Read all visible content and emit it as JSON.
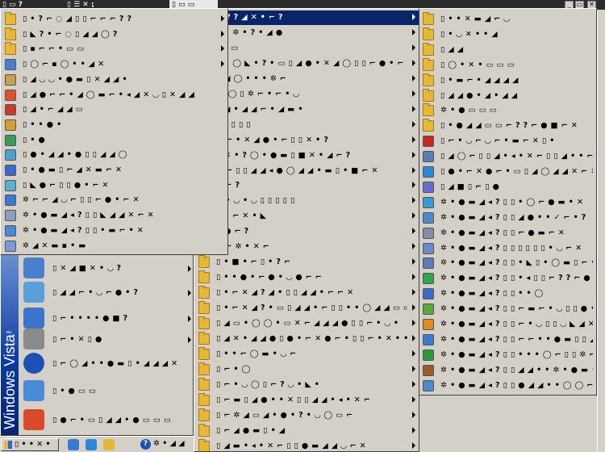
{
  "top_strip": {
    "item1": "▯ ▭ ?",
    "item2": "▯ ☰ ✕ ⁏",
    "item3": "▯ ▭ ▭",
    "win_controls": [
      "_",
      "▭",
      "✕"
    ]
  },
  "panel1": {
    "rows": [
      {
        "label": "▯ • ? ⌐ ◌ ◢ ▯ ▯ ⌐ ⌐ ⌐ ? ?",
        "icon": "folder",
        "submenu": true
      },
      {
        "label": "▯ ◣ ? • ⌐ ◌ ▯ ◢ ◢ ◯ ?",
        "icon": "folder",
        "submenu": true
      },
      {
        "label": "▯ ▪ ⌐ ⌐ • ▭ ▭",
        "icon": "folder",
        "submenu": true
      },
      {
        "label": "▯ ◯ ⌐ ▪ ◯ • • ◢ ✕",
        "icon": "app",
        "submenu": true
      },
      {
        "label": "▯ ◢ ◡ ◡ • ● ▬ ▯ ✕ ◢ ◢ •",
        "icon": "app",
        "submenu": false
      },
      {
        "label": "▯ ◢ ● ⌐ ⌐ • ◢ ◯ ▬ ⌐ • ◂ ◢ ✕ ◡ ▯ ✕ ◢ ◢",
        "icon": "app",
        "submenu": false
      },
      {
        "label": "▯ ◢ • ⌐ ◢ ◢ ▭",
        "icon": "app",
        "submenu": false
      },
      {
        "label": "▯ • • ● •",
        "icon": "app",
        "submenu": false
      },
      {
        "label": "▯ • ●",
        "icon": "app",
        "submenu": false
      },
      {
        "label": "▯ ● • ◢ ◢ • ● ▯ ▯ ◢ ◢ ◯",
        "icon": "app",
        "submenu": false
      },
      {
        "label": "▯ • ● ▬ ▯ ⌐ ◢ ✕ ▬ ⌐ ✕",
        "icon": "app",
        "submenu": false
      },
      {
        "label": "▯ ◣ ● ⌐ ▯ ▯ ● • ⌐ ✕",
        "icon": "app",
        "submenu": false
      },
      {
        "label": "✲ ⌐ ⌐ ◢ ◡ ⌐ ▯ ▯ ⌐ ● • ⌐ ✕",
        "icon": "app",
        "submenu": false
      },
      {
        "label": "✲ • ● ▬ ◢ ◂ ? ▯ ▯ ◣ ◢ ◢ ✕ ⌐ ✕",
        "icon": "app",
        "submenu": false
      },
      {
        "label": "✲ • ● ▬ ◢ ◂ ? ▯ ▯ • ▬ ⌐ • ✕",
        "icon": "app",
        "submenu": false
      },
      {
        "label": "✲ ◢ ✕ ▬ ▪ • ▬",
        "icon": "app",
        "submenu": false
      }
    ]
  },
  "start_menu": {
    "brand": "Windows Vista",
    "brand_tm": "™",
    "items": [
      {
        "label": "▯ ✕ ◢ ■ ✕ • ◡ ?",
        "color": "#4a7fd0"
      },
      {
        "label": "▯ ◢ ◢ ⌐ • ◡ ⌐ ● • ?",
        "color": "#5aa0d8"
      },
      {
        "label": "▯ ⌐ • • • • ● ■ ?",
        "color": "#3c74c8"
      },
      {
        "label": "▯ ⌐ • ✕ ▯ ●",
        "color": "#8a8a8a"
      },
      {
        "label": "▯ ⌐ ◯ ◢ • • ● ▬ ▯ • ◢ ◢ ◢ ✕",
        "color": "#1e4fb4"
      },
      {
        "label": "▯ • ● ▭ ▭",
        "color": "#4a8ad8"
      },
      {
        "label": "▯ ● ⌐ • ▭ ▯ ◢ ◢ • ● ▭ ▭ ▭",
        "color": "#d84a2a"
      }
    ]
  },
  "panel2": {
    "rows": [
      {
        "label": "⌐ ? ? ◢ ✕ • ⌐ ?",
        "selected": true
      },
      {
        "label": "• • ✲ • ? • ◢ ●",
        "selected": false
      },
      {
        "label": "▯ ◂ ▭",
        "selected": false
      },
      {
        "label": "• • ◯ ◣ • ? • ▭ ▯ ◢ ● • ✕ ◢ ◯ ▯ ▯ ⌐ ● • ⌐ ✕",
        "selected": false
      },
      {
        "label": "• ◢ ◯ • • • ✲ ⌐",
        "selected": false
      },
      {
        "label": "◯ ◯ ▯ ✲ ⌐ • ⌐ • ◡",
        "selected": false
      },
      {
        "label": "• ◢ • ◢ ◢ ⌐ • ◢ ▬ •",
        "selected": false
      },
      {
        "label": "▯ ▯ ▯ ▯ ▯",
        "selected": false
      },
      {
        "label": "⌐ ⌐ • ✕ ◢ ● • ⌐ ▯ ▯ ✕ • ?",
        "selected": false
      },
      {
        "label": "• ✕ • ? ◯ • ● ▬ ▯ ■ ✕ • ◢ ⌐ ?",
        "selected": false
      },
      {
        "label": "⌐ ⌐ ▯ ▯ ◢ ◢ ◂ ● ◯ ◢ ◢ • ▬ ▯ • ■ ⌐ ✕",
        "selected": false
      },
      {
        "label": "◡ ⌐ ?",
        "selected": false
      },
      {
        "label": "◢ • ◡ • ◡ ▯ ▯ ▯ ▯ ▯",
        "selected": false
      },
      {
        "label": "• • ⌐ ✕ • ◣",
        "selected": false
      },
      {
        "label": "• ● ⌐ ?",
        "selected": false
      },
      {
        "label": "◡ ⌐ ✲ • ✕ ⌐",
        "selected": false
      },
      {
        "label": "▯ • ■ • ⌐ ▯ • ? ⌐",
        "selected": false
      },
      {
        "label": "▯ • • ● • ⌐ ● • ◡ ● ⌐ ⌐",
        "selected": false
      },
      {
        "label": "▯ • ⌐ ✕ ◢ ? ◢ • ▯ ▯ ◢ ◢ • ⌐ ⌐ ✕",
        "selected": false
      },
      {
        "label": "▯ • ⌐ ✕ ◢ ? • ▭ ▯ ◢ ◢ • ⌐ ▯ ▯ • • ◯ ◢ ◢ ▭ ▭",
        "selected": false
      },
      {
        "label": "▯ ◢ ▭ • ◯ ◯ • ▭ ✕ ⌐ ◢ ◢ ◢ ● ▯ ▯ ⌐ • ◡ •",
        "selected": false
      },
      {
        "label": "▯ ◢ ✕ • ◢ ◢ ● ▯ ● • ⌐ ✕ ● ⌐ • ▯ ▯ ⌐ • ✕ • • ◣",
        "selected": false
      },
      {
        "label": "▯ • • ⌐ ◯ ▬ • ◡ ⌐",
        "selected": false
      },
      {
        "label": "▯ ⌐ • ◯",
        "selected": false
      },
      {
        "label": "▯ ⌐ • ◡ ◯ ▯ ⌐ ? ◡ • ◣ •",
        "selected": false
      },
      {
        "label": "▯ ⌐ ▬ ▯ ◢ ● • • ✕ ▯ ▯ ◢ ◢ • ◂ • ✕ ⌐",
        "selected": false
      },
      {
        "label": "▯ ⌐ ✲ ◢ ▭ ◢ • ● • ? • ◡ ◯ ▭ ⌐",
        "selected": false
      },
      {
        "label": "▯ ⌐ ◢ ● ▬ ▯ • ◢",
        "selected": false
      },
      {
        "label": "▯ ◢ ▬ • ◂ • ✕ ⌐ ▯ ▯ ● ▬ ◢ ◢ ◡ ⌐ ✕",
        "selected": false
      }
    ]
  },
  "panel3": {
    "rows": [
      {
        "label": "▯ • • ✕ ▬ ◢ ⌐ ◡",
        "icon": "folder",
        "color": "#e6b83a"
      },
      {
        "label": "▯ • ◡ ✕ • • ◢",
        "icon": "folder",
        "color": "#e6b83a"
      },
      {
        "label": "▯ ◢ ◢",
        "icon": "folder",
        "color": "#e6b83a"
      },
      {
        "label": "▯ ◯ • ✕ • ▭ ▭ ▭",
        "icon": "folder",
        "color": "#e6b83a"
      },
      {
        "label": "▯ • ▬ ⌐ • ◢ ◢ ◢ ◢",
        "icon": "folder",
        "color": "#e6b83a"
      },
      {
        "label": "▯ ◢ ◢ ● • ◢ • ◢ ◢",
        "icon": "folder",
        "color": "#e6b83a"
      },
      {
        "label": "✲ • ● ▭ ▭ ▭",
        "icon": "folder",
        "color": "#e6b83a"
      },
      {
        "label": "▯ • ● ◢ ◢ ▭ ▭ ⌐ ? ? ⌐ ● ■ ⌐ ✕",
        "icon": "folder",
        "color": "#e6b83a"
      },
      {
        "label": "▯ ⌐ • ◡ ⌐ ◡ ⌐ • ▬ ⌐ ✕ ▯ •",
        "icon": "app",
        "color": "#c8281e"
      },
      {
        "label": "▯ ◢ ◯ ⌐ ▯ ▯ ◢ • ◂ • ✕ ⌐ ▯ ▯ ◢ • • ⌐",
        "icon": "app",
        "color": "#5a7ab8"
      },
      {
        "label": "▯ ● • ⌐ ✕ ● ⌐ • ▭ ▯ ◢ ◯ ◢ ◢ ✕ ⌐ ✕",
        "icon": "app",
        "color": "#2a8ad8"
      },
      {
        "label": "▯ ◢ ■ ▯ ⌐ ▯ ●",
        "icon": "app",
        "color": "#6a6ad0"
      },
      {
        "label": "✲ • ● ▬ ◢ ◂ ? ▯ ▯ • ◯ ⌐ ● ▬ • ✕",
        "icon": "app",
        "color": "#3a9ad8"
      },
      {
        "label": "✲ • ● ▬ ◢ ◂ ? ▯ ▯ ◢ ● • • ✓ ⌐ • ?",
        "icon": "app",
        "color": "#4a8ac8"
      },
      {
        "label": "✲ • ● ▬ ◢ ◂ ? ▯ ▯ ⌐ ● ▬ ⌐ ✕",
        "icon": "app",
        "color": "#8a8aa8"
      },
      {
        "label": "✲ • ● ▬ ◢ ◂ ? ▯ ▯ ▯ ▯ ▯ ▯ • ◡ ⌐ ✕",
        "icon": "app",
        "color": "#6a8ac8"
      },
      {
        "label": "✲ • ● ▬ ◢ ◂ ? ▯ ▯ • ◣ ▯ • ◯ ▬ ▯ ⌐ • ●",
        "icon": "app",
        "color": "#5a7ab8"
      },
      {
        "label": "✲ • ● ▬ ◢ ◂ ? ▯ ▯ • ◂ ▯ ▯ ⌐ ? ? ⌐ ● ■ ⌐ ✕",
        "icon": "app",
        "color": "#2aa84a"
      },
      {
        "label": "✲ • ● ▬ ◢ ◂ ? ▯ ▯ • • ◯",
        "icon": "app",
        "color": "#3a6ac8"
      },
      {
        "label": "✲ • ● ▬ ◢ ◂ ? ▯ ▯ ⌐ ▬ ⌐ • ◡ ▯ ▯ ● • ⌐ ✕",
        "icon": "app",
        "color": "#5aa83a"
      },
      {
        "label": "✲ • ● ▬ ◢ ◂ ? ▯ ▯ ⌐ • ◡ ▯ ▯ ◡ ◣ ◢ ✕",
        "icon": "app",
        "color": "#e08a1e"
      },
      {
        "label": "✲ • ● ▬ ◢ ◂ ? ▯ ▯ ⌐ ⌐ • • ● ▬ ▯ ▯ ◢ ◢ ◯",
        "icon": "app",
        "color": "#3a7ad0"
      },
      {
        "label": "✲ • ● ▬ ◢ ◂ ? ▯ ▯ • • • ◯ ⌐ ▯ ▯ ✲ ⌐ ⌐",
        "icon": "app",
        "color": "#2a9a3a"
      },
      {
        "label": "✲ • ● ▬ ◢ ◂ ? ▯ ▯ ◢ ◢ • • ✲ • ● ▬ • ✕",
        "icon": "app",
        "color": "#9a5a2a"
      },
      {
        "label": "✲ • ● ▬ ◢ ◂ ? ▯ ▯ ● ◢ ◢ • • ◯ ◯ ⌐ ✕ ◣",
        "icon": "app",
        "color": "#4a8ac8"
      }
    ]
  },
  "taskbar": {
    "start_label": "▯ • • ✕ •",
    "tray_label": "✲ • ◢ ◢",
    "help_glyph": "?"
  }
}
